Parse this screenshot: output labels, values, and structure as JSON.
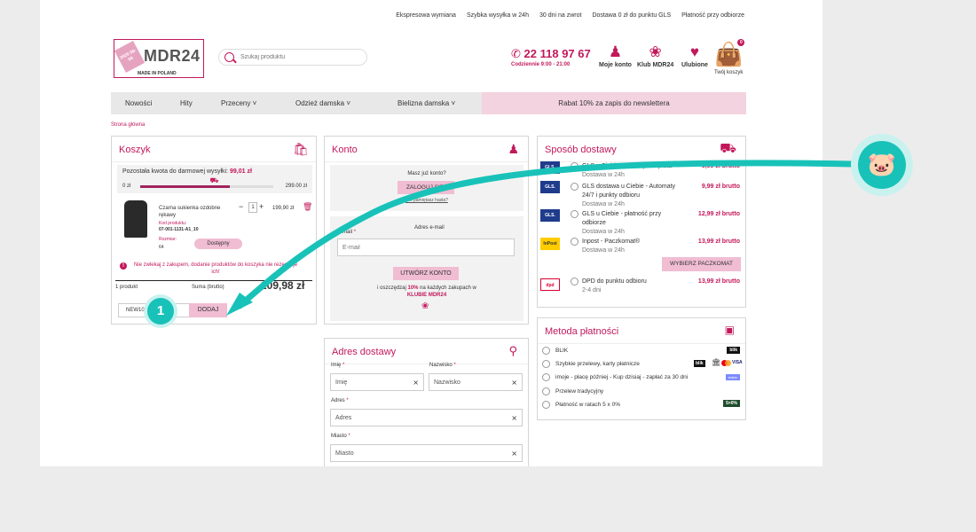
{
  "topbar": [
    "Ekspresowa wymiana",
    "Szybka wysyłka w 24h",
    "30 dni na zwrot",
    "Dostawa 0 zł do punktu GLS",
    "Płatność przy odbiorze"
  ],
  "logo": {
    "tag": "2020 06-06",
    "name": "MDR24",
    "sub": "MADE IN POLAND"
  },
  "search": {
    "placeholder": "Szukaj produktu"
  },
  "phone": {
    "number": "22 118 97 67",
    "hours": "Codziennie 9:00 - 21:00"
  },
  "header_icons": {
    "account": "Moje konto",
    "club": "Klub MDR24",
    "favorites": "Ulubione",
    "cart": "Twój koszyk",
    "cart_count": "0"
  },
  "nav": {
    "items": [
      "Nowości",
      "Hity",
      "Przeceny ˅",
      "Odzież damska ˅",
      "Bielizna damska ˅"
    ],
    "promo": "Rabat 10% za zapis do newslettera"
  },
  "breadcrumb": "Strona główna",
  "cart": {
    "title": "Koszyk",
    "free_shipping_text": "Pozostała kwota do darmowej wysyłki:",
    "free_shipping_amount": "99,01 zł",
    "progress_min": "0 zł",
    "progress_max": "299.00 zł",
    "progress_fraction": 0.67,
    "product_name": "Czarna sukienka ozdobne rękawy",
    "code_label": "Kod produktu:",
    "code": "07-001-1131-A1_10",
    "size_label": "Rozmiar:",
    "size": "64",
    "qty_minus": "−",
    "qty": "1",
    "qty_plus": "+",
    "price": "199,90 zł",
    "availability": "Dostępny",
    "warning": "Nie zwlekaj z zakupem, dodanie produktów do koszyka nie rezerwuje ich!",
    "count": "1 produkt",
    "sum_label": "Suma (brutto)",
    "sum": "209,98 zł",
    "coupon_value": "NEW10",
    "coupon_button": "DODAJ"
  },
  "account": {
    "title": "Konto",
    "have_account": "Masz już konto?",
    "login_button": "ZALOGUJ SIĘ!",
    "forgot": "Nie pamiętasz hasła?",
    "email_hint": "Adres e-mail",
    "email_label": "E-mail",
    "email_placeholder": "E-mail",
    "create_button": "UTWÓRZ KONTO",
    "savings_pre": "i oszczędzaj",
    "savings_pct": "10%",
    "savings_post": "na każdych zakupach w",
    "club_name": "KLUBIE MDR24"
  },
  "delivery": {
    "title": "Sposób dostawy",
    "options": [
      {
        "carrier": "GLS.",
        "name": "GLS u Ciebie - Kurier przedpłata",
        "sub": "Dostawa w 24h",
        "price": "9,99 zł brutto"
      },
      {
        "carrier": "GLS.",
        "name": "GLS dostawa u Ciebie - Automaty 24/7 i punkty odbioru",
        "sub": "Dostawa w 24h",
        "price": "9,99 zł brutto"
      },
      {
        "carrier": "GLS.",
        "name": "GLS u Ciebie - płatność przy odbiorze",
        "sub": "Dostawa w 24h",
        "price": "12,99 zł brutto"
      },
      {
        "carrier": "InPost",
        "name": "Inpost - Paczkomat®",
        "sub": "Dostawa w 24h",
        "price": "13,99 zł brutto"
      },
      {
        "carrier": "dpd",
        "name": "DPD do punktu odbioru",
        "sub": "2-4 dni",
        "price": "13,99 zł brutto"
      }
    ],
    "locker_button": "WYBIERZ PACZKOMAT"
  },
  "payment": {
    "title": "Metoda płatności",
    "options": [
      "BLIK",
      "Szybkie przelewy, karty płatnicze",
      "imoje - płacę później - Kup dzisiaj - zapłać za 30 dni",
      "Przelew tradycyjny",
      "Płatność w ratach 5 x 0%"
    ],
    "badges": {
      "blik": "blik",
      "blik2": "blik",
      "visa": "VISA",
      "twisto": "twisto",
      "raty": "5×0%"
    }
  },
  "address": {
    "title": "Adres dostawy",
    "first_name_label": "Imię",
    "first_name_placeholder": "Imię",
    "last_name_label": "Nazwisko",
    "last_name_placeholder": "Nazwisko",
    "address_label": "Adres",
    "address_placeholder": "Adres",
    "city_label": "Miasto",
    "city_placeholder": "Miasto"
  },
  "annotation": {
    "step": "1"
  },
  "colors": {
    "brand": "#c2185b",
    "button_pink": "#f0bdd2",
    "accent_teal": "#19c2b9",
    "nav_bg": "#e8e8e8",
    "promo_bg": "#f3d3df"
  }
}
